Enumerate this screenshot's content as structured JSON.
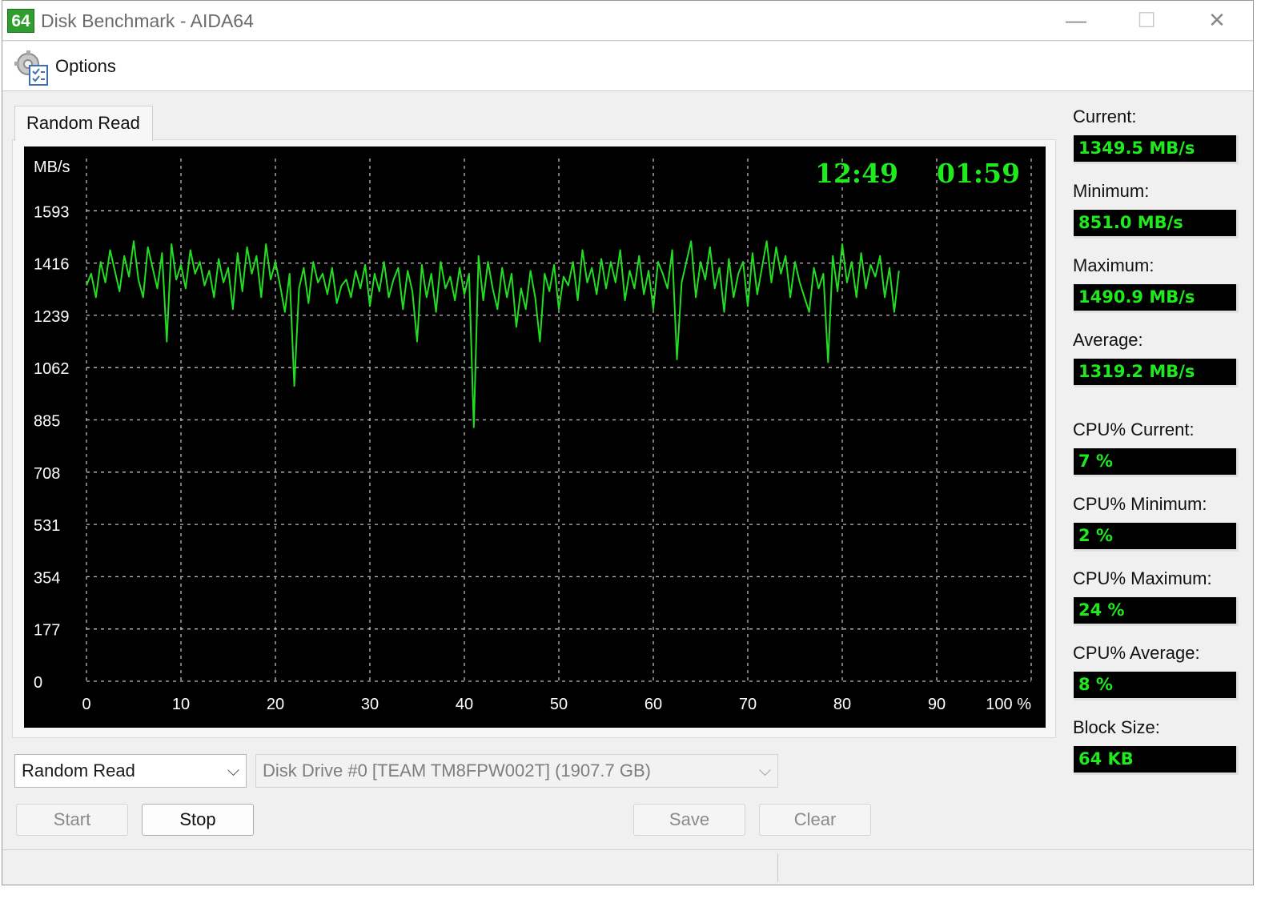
{
  "window": {
    "app_icon_text": "64",
    "title": "Disk Benchmark - AIDA64",
    "controls": {
      "minimize": "—",
      "maximize": "☐",
      "close": "✕"
    }
  },
  "menu": {
    "options_label": "Options",
    "options_icon": "options-gear-checklist-icon"
  },
  "tab": {
    "label": "Random Read"
  },
  "chart_overlay": {
    "elapsed_time": "12:49",
    "remaining_time": "01:59"
  },
  "chart_data": {
    "type": "line",
    "ylabel": "MB/s",
    "xlabel": "",
    "x_ticks": [
      "0",
      "10",
      "20",
      "30",
      "40",
      "50",
      "60",
      "70",
      "80",
      "90",
      "100 %"
    ],
    "y_ticks": [
      "0",
      "177",
      "354",
      "531",
      "708",
      "885",
      "1062",
      "1239",
      "1416",
      "1593"
    ],
    "xlim": [
      0,
      100
    ],
    "ylim": [
      0,
      1770
    ],
    "grid": true,
    "series": [
      {
        "color": "#22dd22",
        "x": [
          0,
          0.5,
          1,
          1.5,
          2,
          2.5,
          3,
          3.5,
          4,
          4.5,
          5,
          5.5,
          6,
          6.5,
          7,
          7.5,
          8,
          8.5,
          9,
          9.5,
          10,
          10.5,
          11,
          11.5,
          12,
          12.5,
          13,
          13.5,
          14,
          14.5,
          15,
          15.5,
          16,
          16.5,
          17,
          17.5,
          18,
          18.5,
          19,
          19.5,
          20,
          20.5,
          21,
          21.5,
          22,
          22.5,
          23,
          23.5,
          24,
          24.5,
          25,
          25.5,
          26,
          26.5,
          27,
          27.5,
          28,
          28.5,
          29,
          29.5,
          30,
          30.5,
          31,
          31.5,
          32,
          32.5,
          33,
          33.5,
          34,
          34.5,
          35,
          35.5,
          36,
          36.5,
          37,
          37.5,
          38,
          38.5,
          39,
          39.5,
          40,
          40.5,
          41,
          41.5,
          42,
          42.5,
          43,
          43.5,
          44,
          44.5,
          45,
          45.5,
          46,
          46.5,
          47,
          47.5,
          48,
          48.5,
          49,
          49.5,
          50,
          50.5,
          51,
          51.5,
          52,
          52.5,
          53,
          53.5,
          54,
          54.5,
          55,
          55.5,
          56,
          56.5,
          57,
          57.5,
          58,
          58.5,
          59,
          59.5,
          60,
          60.5,
          61,
          61.5,
          62,
          62.5,
          63,
          63.5,
          64,
          64.5,
          65,
          65.5,
          66,
          66.5,
          67,
          67.5,
          68,
          68.5,
          69,
          69.5,
          70,
          70.5,
          71,
          71.5,
          72,
          72.5,
          73,
          73.5,
          74,
          74.5,
          75,
          75.5,
          76,
          76.5,
          77,
          77.5,
          78,
          78.5,
          79,
          79.5,
          80,
          80.5,
          81,
          81.5,
          82,
          82.5,
          83,
          83.5,
          84,
          84.5,
          85,
          85.5,
          86
        ],
        "y": [
          1340,
          1380,
          1300,
          1420,
          1350,
          1460,
          1390,
          1320,
          1440,
          1370,
          1490,
          1360,
          1300,
          1470,
          1400,
          1330,
          1450,
          1150,
          1480,
          1360,
          1410,
          1330,
          1460,
          1380,
          1420,
          1340,
          1390,
          1300,
          1430,
          1350,
          1400,
          1260,
          1450,
          1320,
          1470,
          1380,
          1440,
          1300,
          1480,
          1360,
          1420,
          1340,
          1250,
          1380,
          1000,
          1330,
          1400,
          1280,
          1420,
          1350,
          1380,
          1310,
          1400,
          1280,
          1340,
          1360,
          1300,
          1390,
          1330,
          1410,
          1270,
          1380,
          1320,
          1420,
          1300,
          1360,
          1400,
          1260,
          1390,
          1320,
          1150,
          1410,
          1300,
          1380,
          1250,
          1420,
          1330,
          1370,
          1290,
          1400,
          1310,
          1380,
          860,
          1440,
          1290,
          1420,
          1330,
          1260,
          1400,
          1300,
          1380,
          1200,
          1330,
          1260,
          1390,
          1300,
          1150,
          1380,
          1320,
          1410,
          1260,
          1370,
          1340,
          1420,
          1290,
          1460,
          1350,
          1400,
          1310,
          1430,
          1330,
          1420,
          1350,
          1460,
          1290,
          1390,
          1330,
          1440,
          1310,
          1390,
          1260,
          1420,
          1380,
          1330,
          1460,
          1090,
          1350,
          1420,
          1490,
          1300,
          1420,
          1360,
          1470,
          1330,
          1400,
          1250,
          1430,
          1300,
          1380,
          1420,
          1270,
          1450,
          1310,
          1400,
          1490,
          1350,
          1470,
          1380,
          1440,
          1300,
          1420,
          1350,
          1300,
          1250,
          1400,
          1330,
          1380,
          1080,
          1440,
          1320,
          1480,
          1350,
          1420,
          1300,
          1450,
          1330,
          1410,
          1370,
          1440,
          1300,
          1400,
          1250,
          1390
        ]
      }
    ]
  },
  "stats": [
    {
      "key": "current",
      "label": "Current:",
      "value": "1349.5 MB/s"
    },
    {
      "key": "minimum",
      "label": "Minimum:",
      "value": "851.0 MB/s"
    },
    {
      "key": "maximum",
      "label": "Maximum:",
      "value": "1490.9 MB/s"
    },
    {
      "key": "average",
      "label": "Average:",
      "value": "1319.2 MB/s"
    },
    {
      "key": "cpu-current",
      "label": "CPU% Current:",
      "value": "7 %"
    },
    {
      "key": "cpu-minimum",
      "label": "CPU% Minimum:",
      "value": "2 %"
    },
    {
      "key": "cpu-maximum",
      "label": "CPU% Maximum:",
      "value": "24 %"
    },
    {
      "key": "cpu-average",
      "label": "CPU% Average:",
      "value": "8 %"
    },
    {
      "key": "block-size",
      "label": "Block Size:",
      "value": "64 KB"
    }
  ],
  "controls": {
    "test_select": {
      "selected": "Random Read"
    },
    "drive_select": {
      "selected": "Disk Drive #0  [TEAM TM8FPW002T]  (1907.7 GB)"
    },
    "buttons": {
      "start": "Start",
      "stop": "Stop",
      "save": "Save",
      "clear": "Clear"
    }
  }
}
